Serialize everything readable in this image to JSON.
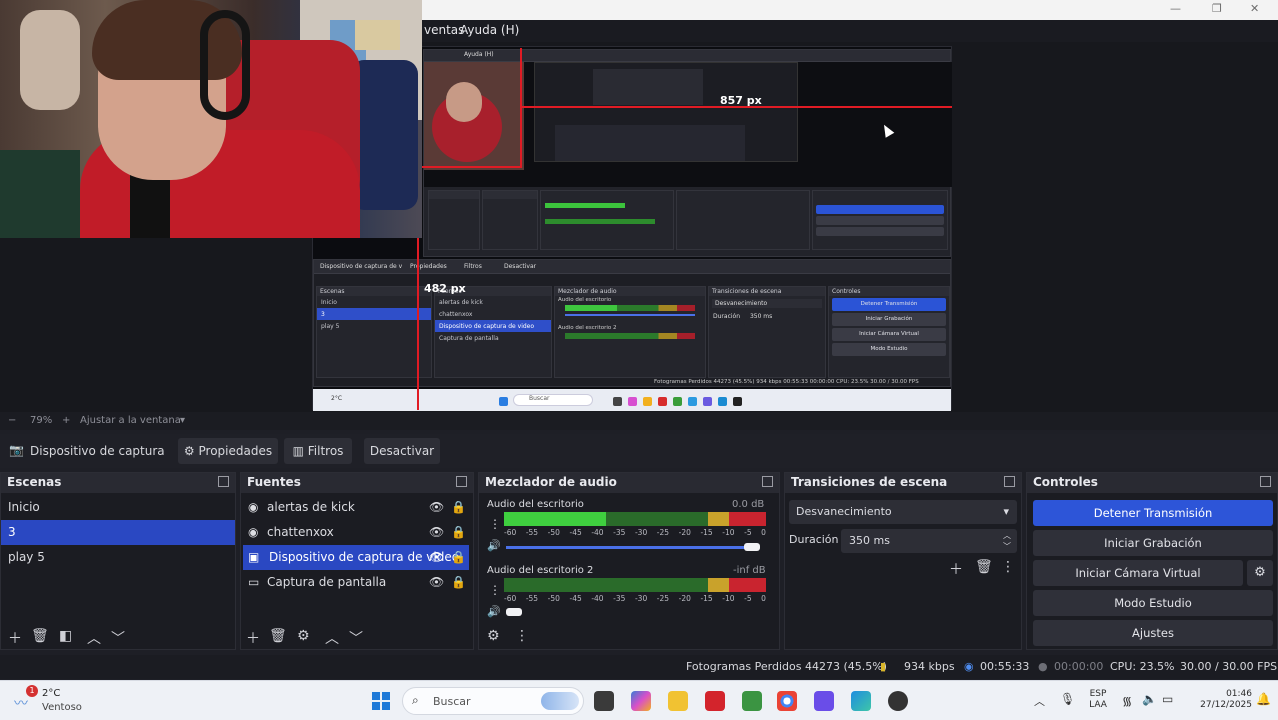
{
  "window": {
    "minimize": "—",
    "maximize": "❐",
    "close": "✕"
  },
  "menubar": {
    "menus": [
      "ventas",
      "Ayuda (H)"
    ]
  },
  "preview": {
    "measure_h": "857 px",
    "measure_v": "482 px",
    "nested": {
      "menus": [
        "Ayuda (H)"
      ],
      "toolbar": [
        "Dispositivo de captura de v",
        "Propiedades",
        "Filtros",
        "Desactivar"
      ],
      "scenes_title": "Escenas",
      "scenes": [
        "Inicio",
        "3",
        "play 5"
      ],
      "sources_title": "Fuentes",
      "sources": [
        "alertas de kick",
        "chattenxox",
        "Dispositivo de captura de video",
        "Captura de pantalla"
      ],
      "mixer_title": "Mezclador de audio",
      "mixer_tracks": [
        "Audio del escritorio",
        "Audio del escritorio 2"
      ],
      "transitions_title": "Transiciones de escena",
      "transition": "Desvanecimiento",
      "duration_label": "Duración",
      "duration": "350 ms",
      "controls_title": "Controles",
      "controls": [
        "Detener Transmisión",
        "Iniciar Grabación",
        "Iniciar Cámara Virtual",
        "Modo Estudio",
        "Ajustes"
      ],
      "status": "Fotogramas Perdidos 44273 (45.5%)   934 kbps   00:55:33   00:00:00   CPU: 23.5%   30.00 / 30.00 FPS",
      "search": "Buscar",
      "weather": "2°C"
    }
  },
  "zoom": {
    "minus": "−",
    "value": "79%",
    "plus": "+",
    "fit": "Ajustar a la ventana"
  },
  "source_toolbar": {
    "source_name": "Dispositivo de captura de v",
    "properties": "Propiedades",
    "filters": "Filtros",
    "deactivate": "Desactivar"
  },
  "scenes": {
    "title": "Escenas",
    "items": [
      "Inicio",
      "3",
      "play 5"
    ],
    "selected": 1
  },
  "sources": {
    "title": "Fuentes",
    "items": [
      {
        "label": "alertas de kick",
        "icon": "globe-icon"
      },
      {
        "label": "chattenxox",
        "icon": "globe-icon"
      },
      {
        "label": "Dispositivo de captura de video",
        "icon": "camera-icon"
      },
      {
        "label": "Captura de pantalla",
        "icon": "monitor-icon"
      }
    ],
    "selected": 2
  },
  "mixer": {
    "title": "Mezclador de audio",
    "tracks": [
      {
        "name": "Audio del escritorio",
        "level": "0.0 dB",
        "fill": 0.39,
        "volume": 1.0
      },
      {
        "name": "Audio del escritorio 2",
        "level": "-inf dB",
        "fill": 0.0,
        "volume": 0.0
      }
    ],
    "ticks": [
      "-60",
      "-55",
      "-50",
      "-45",
      "-40",
      "-35",
      "-30",
      "-25",
      "-20",
      "-15",
      "-10",
      "-5",
      "0"
    ]
  },
  "transitions": {
    "title": "Transiciones de escena",
    "selected": "Desvanecimiento",
    "duration_label": "Duración",
    "duration": "350 ms"
  },
  "controls": {
    "title": "Controles",
    "stop_stream": "Detener Transmisión",
    "start_recording": "Iniciar Grabación",
    "start_virtual_cam": "Iniciar Cámara Virtual",
    "studio_mode": "Modo Estudio",
    "settings": "Ajustes"
  },
  "status": {
    "dropped": "Fotogramas Perdidos 44273 (45.5%)",
    "bitrate": "934 kbps",
    "stream_time": "00:55:33",
    "rec_time": "00:00:00",
    "cpu": "CPU: 23.5%",
    "fps": "30.00 / 30.00 FPS"
  },
  "taskbar": {
    "weather_temp": "2°C",
    "weather_desc": "Ventoso",
    "weather_badge": "1",
    "search_placeholder": "Buscar",
    "lang_1": "ESP",
    "lang_2": "LAA",
    "time": "01:46",
    "date": "27/12/2025"
  },
  "colors": {
    "accent": "#2d55d8",
    "meter_green": "#3fcf3f",
    "meter_yellow": "#c9a22b",
    "meter_red": "#c9242f",
    "measure_red": "#e01b24"
  }
}
